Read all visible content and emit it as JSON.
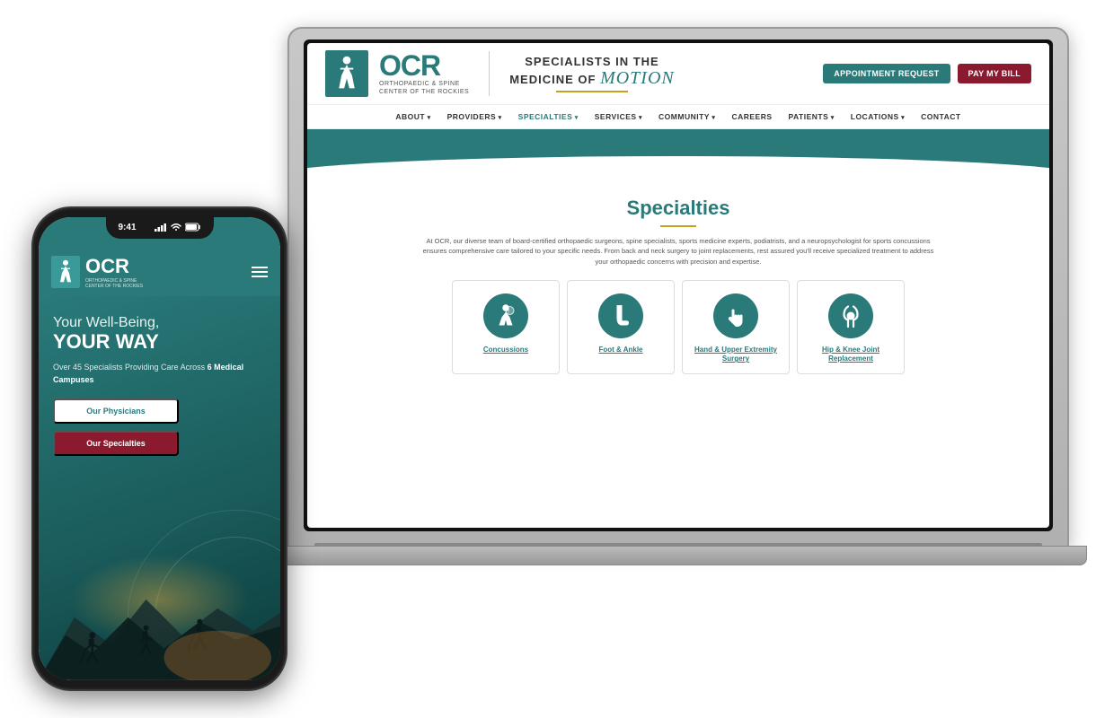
{
  "scene": {
    "background": "#f0f0f0"
  },
  "laptop": {
    "website": {
      "header": {
        "logo_ocr": "OCR",
        "logo_subtitle_line1": "ORTHOPAEDIC & SPINE",
        "logo_subtitle_line2": "CENTER OF THE ROCKIES",
        "tagline_line1": "SPECIALISTS IN THE",
        "tagline_line2": "MEDICINE OF",
        "tagline_motion": "motion",
        "btn_appointment": "Appointment Request",
        "btn_pay": "Pay My Bill"
      },
      "nav": {
        "items": [
          {
            "label": "ABOUT",
            "has_arrow": true
          },
          {
            "label": "PROVIDERS",
            "has_arrow": true
          },
          {
            "label": "SPECIALTIES",
            "has_arrow": true,
            "active": true
          },
          {
            "label": "SERVICES",
            "has_arrow": true
          },
          {
            "label": "COMMUNITY",
            "has_arrow": true
          },
          {
            "label": "CAREERS",
            "has_arrow": false
          },
          {
            "label": "PATIENTS",
            "has_arrow": true
          },
          {
            "label": "LOCATIONS",
            "has_arrow": true
          },
          {
            "label": "CONTACT",
            "has_arrow": false
          }
        ]
      },
      "specialties": {
        "title": "Specialties",
        "description": "At OCR, our diverse team of board-certified orthopaedic surgeons, spine specialists, sports medicine experts, podiatrists, and a neuropsychologist for sports concussions ensures comprehensive care tailored to your specific needs. From back and neck surgery to joint replacements, rest assured you'll receive specialized treatment to address your orthopaedic concerns with precision and expertise.",
        "cards": [
          {
            "label": "Concussions"
          },
          {
            "label": "Foot & Ankle"
          },
          {
            "label": "Hand & Upper Extremity Surgery"
          },
          {
            "label": "Hip & Knee Joint Replacement"
          }
        ]
      }
    }
  },
  "phone": {
    "status": {
      "time": "9:41"
    },
    "header": {
      "logo_ocr": "OCR",
      "logo_subtitle_line1": "ORTHOPAEDIC & SPINE",
      "logo_subtitle_line2": "CENTER OF THE ROCKIES"
    },
    "hero": {
      "line1": "Your Well-Being,",
      "line2": "YOUR WAY",
      "description_pre": "Over 45 Specialists Providing Care Across ",
      "description_bold": "6 Medical Campuses",
      "btn_physicians": "Our Physicians",
      "btn_specialties": "Our Specialties"
    }
  }
}
